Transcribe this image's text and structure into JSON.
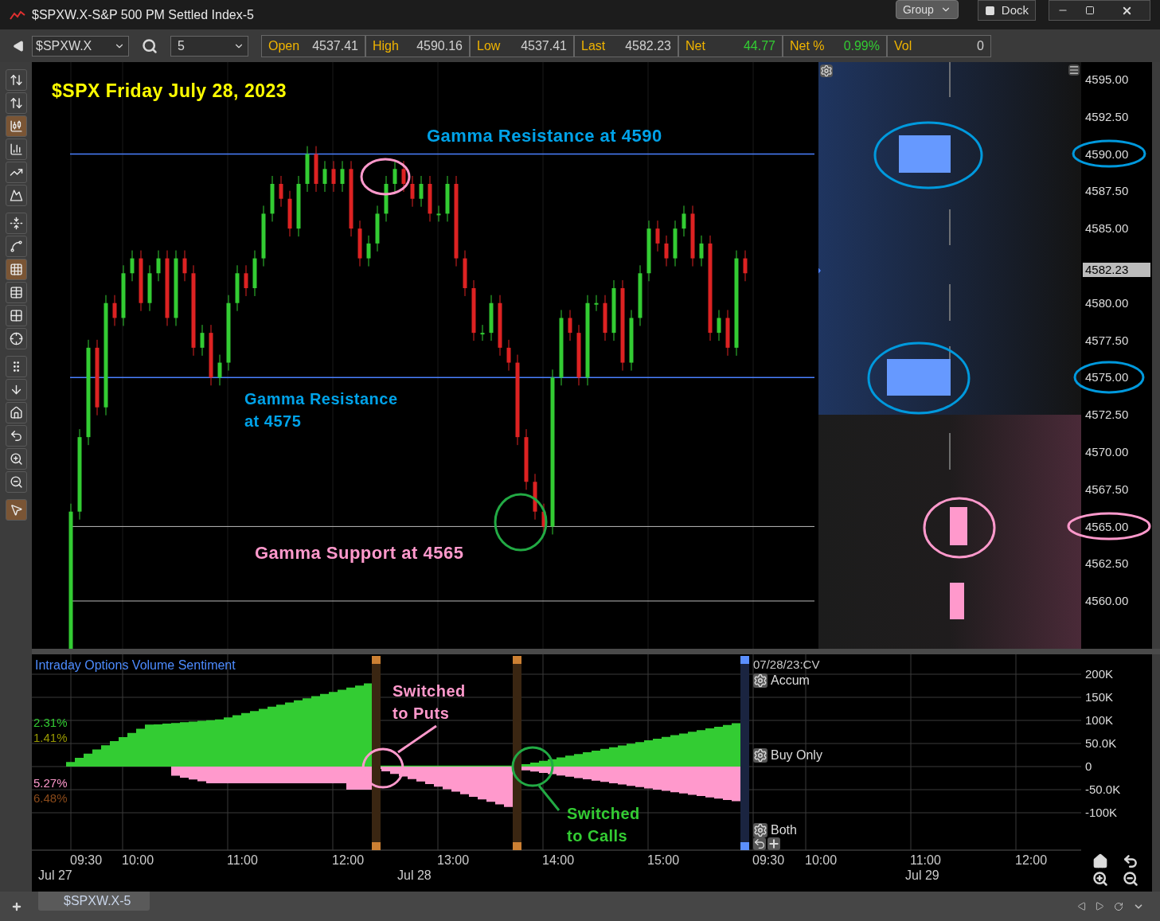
{
  "window": {
    "title": "$SPXW.X-S&P 500 PM Settled Index-5",
    "group_button": "Group",
    "dock_button": "Dock"
  },
  "toolbar": {
    "symbol": "$SPXW.X",
    "interval": "5",
    "quote": [
      {
        "label": "Open",
        "value": "4537.41",
        "color": "#d0d0d0"
      },
      {
        "label": "High",
        "value": "4590.16",
        "color": "#d0d0d0"
      },
      {
        "label": "Low",
        "value": "4537.41",
        "color": "#d0d0d0"
      },
      {
        "label": "Last",
        "value": "4582.23",
        "color": "#d0d0d0"
      },
      {
        "label": "Net",
        "value": "44.77",
        "color": "#33cc33"
      },
      {
        "label": "Net %",
        "value": "0.99%",
        "color": "#33cc33"
      },
      {
        "label": "Vol",
        "value": "0",
        "color": "#d0d0d0"
      }
    ]
  },
  "chart_tools": [
    {
      "kind": "ohlc",
      "selected": false
    },
    {
      "kind": "hlc",
      "selected": false
    },
    {
      "kind": "candle",
      "selected": true
    },
    {
      "kind": "column",
      "selected": false
    },
    {
      "kind": "line",
      "selected": false
    },
    {
      "kind": "area",
      "selected": false
    },
    {
      "kind": "autoscale",
      "selected": false
    },
    {
      "kind": "log",
      "selected": false
    },
    {
      "kind": "grid",
      "selected": true
    },
    {
      "kind": "table",
      "selected": false
    },
    {
      "kind": "small-grid",
      "selected": false
    },
    {
      "kind": "crosshair",
      "selected": false
    },
    {
      "kind": "grip",
      "selected": false
    },
    {
      "kind": "down",
      "selected": false
    },
    {
      "kind": "home",
      "selected": false
    },
    {
      "kind": "undo",
      "selected": false
    },
    {
      "kind": "zoom-in",
      "selected": false
    },
    {
      "kind": "zoom-out",
      "selected": false
    },
    {
      "kind": "pointer",
      "selected": true
    }
  ],
  "price_chart": {
    "annotations": [
      {
        "text": "$SPX Friday July 28, 2023",
        "color": "#ffff00"
      },
      {
        "text": "Gamma Resistance at 4590",
        "color": "#00a2e8"
      },
      {
        "text": "Gamma Resistance at 4575",
        "color": "#00a2e8"
      },
      {
        "text": "Gamma Support at 4565",
        "color": "#ff99cc"
      }
    ],
    "price_axis": [
      "4595.00",
      "4592.50",
      "4590.00",
      "4587.50",
      "4585.00",
      "4580.00",
      "4577.50",
      "4575.00",
      "4572.50",
      "4570.00",
      "4567.50",
      "4565.00",
      "4562.50",
      "4560.00"
    ],
    "last_price": "4582.23"
  },
  "sentiment_panel": {
    "title": "Intraday Options Volume Sentiment",
    "percent_labels": [
      {
        "text": "2.31%",
        "color": "#33cc33"
      },
      {
        "text": "1.41%",
        "color": "#999900"
      },
      {
        "text": "5.27%",
        "color": "#ff99cc"
      },
      {
        "text": "6.48%",
        "color": "#8a4a1a"
      }
    ],
    "legend_date": "07/28/23:CV",
    "legend_items": [
      "Accum",
      "Buy Only",
      "Both"
    ],
    "value_axis": [
      "200K",
      "150K",
      "100K",
      "50.0K",
      "0",
      "-50.0K",
      "-100K"
    ],
    "annotations": [
      {
        "text": "Switched to Puts",
        "color": "#ff99cc"
      },
      {
        "text": "Switched to Calls",
        "color": "#33cc33"
      }
    ],
    "time_axis": [
      "09:30",
      "10:00",
      "11:00",
      "12:00",
      "13:00",
      "14:00",
      "15:00",
      "09:30",
      "10:00",
      "11:00",
      "12:00"
    ],
    "dates": [
      "Jul 27",
      "Jul 28",
      "Jul 29"
    ]
  },
  "tabs": [
    {
      "label": "$SPXW.X-5",
      "selected": true
    }
  ]
}
